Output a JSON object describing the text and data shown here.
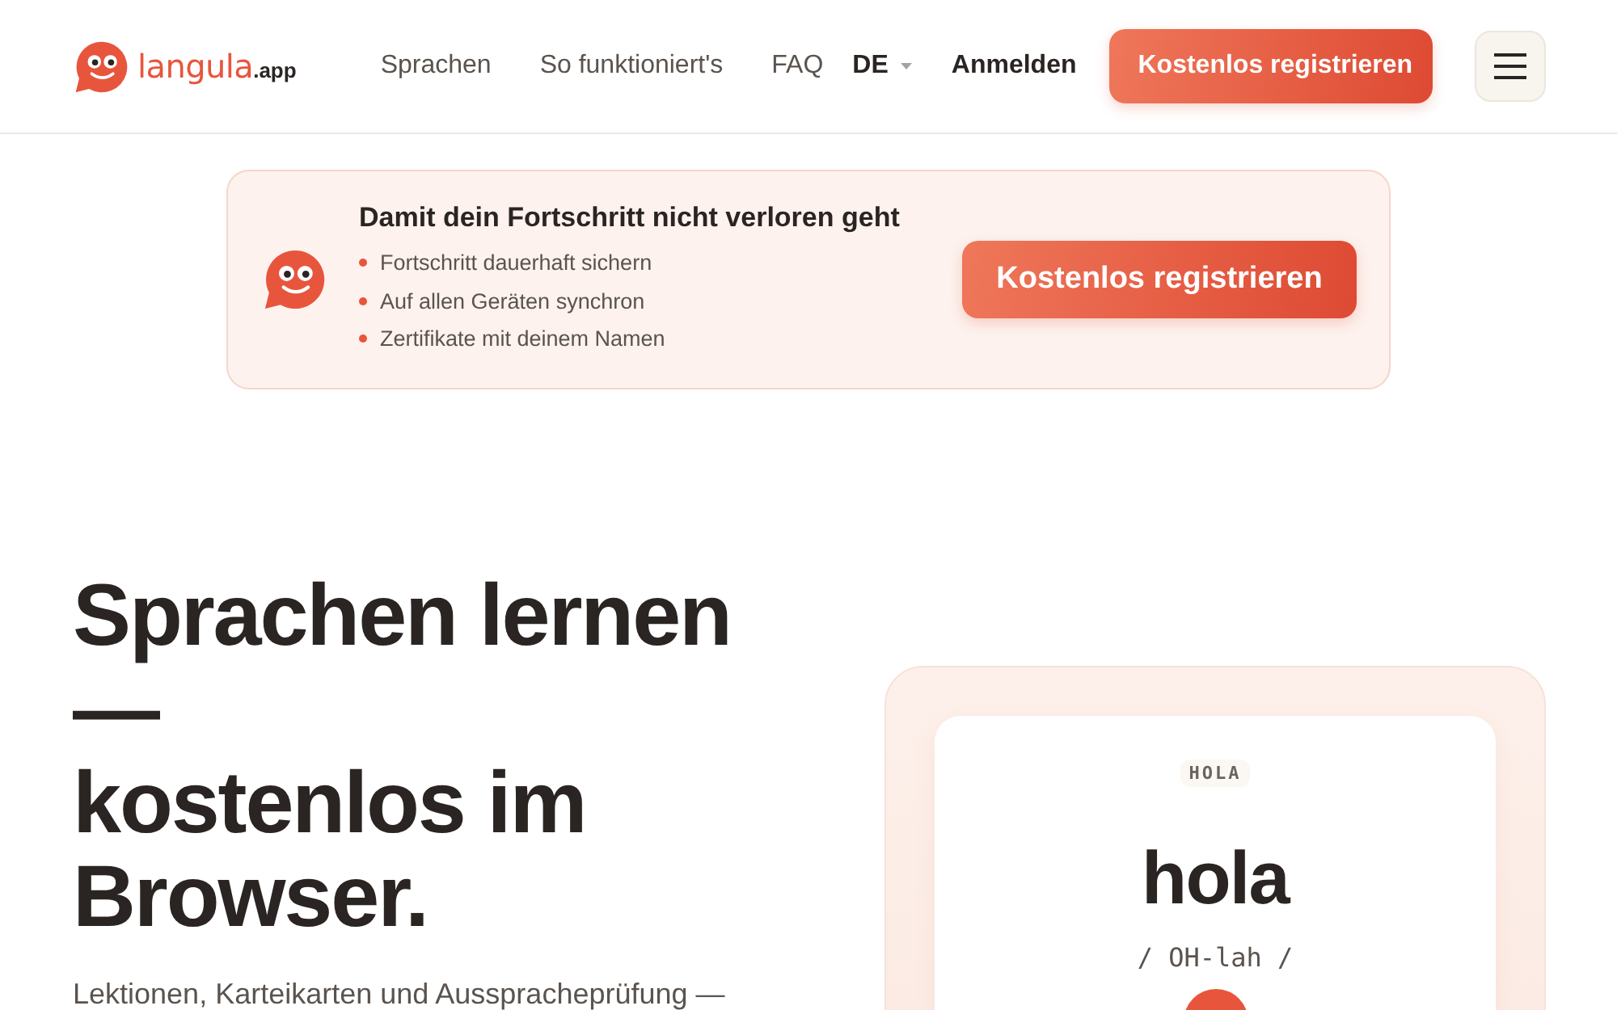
{
  "header": {
    "logo": {
      "name": "langula",
      "suffix": ".app"
    },
    "nav": [
      "Sprachen",
      "So funktioniert's",
      "FAQ"
    ],
    "language": "DE",
    "login": "Anmelden",
    "register": "Kostenlos registrieren"
  },
  "banner": {
    "title": "Damit dein Fortschritt nicht verloren geht",
    "points": [
      "Fortschritt dauerhaft sichern",
      "Auf allen Geräten synchron",
      "Zertifikate mit deinem Namen"
    ],
    "button": "Kostenlos registrieren"
  },
  "hero": {
    "title_lines": [
      "Sprachen lernen",
      "—",
      "kostenlos im",
      "Browser."
    ],
    "subtitle": "Lektionen, Karteikarten und Ausspracheprüfung —"
  },
  "flashcard": {
    "tag": "HOLA",
    "word": "hola",
    "pronunciation": "/ OH-lah /"
  }
}
